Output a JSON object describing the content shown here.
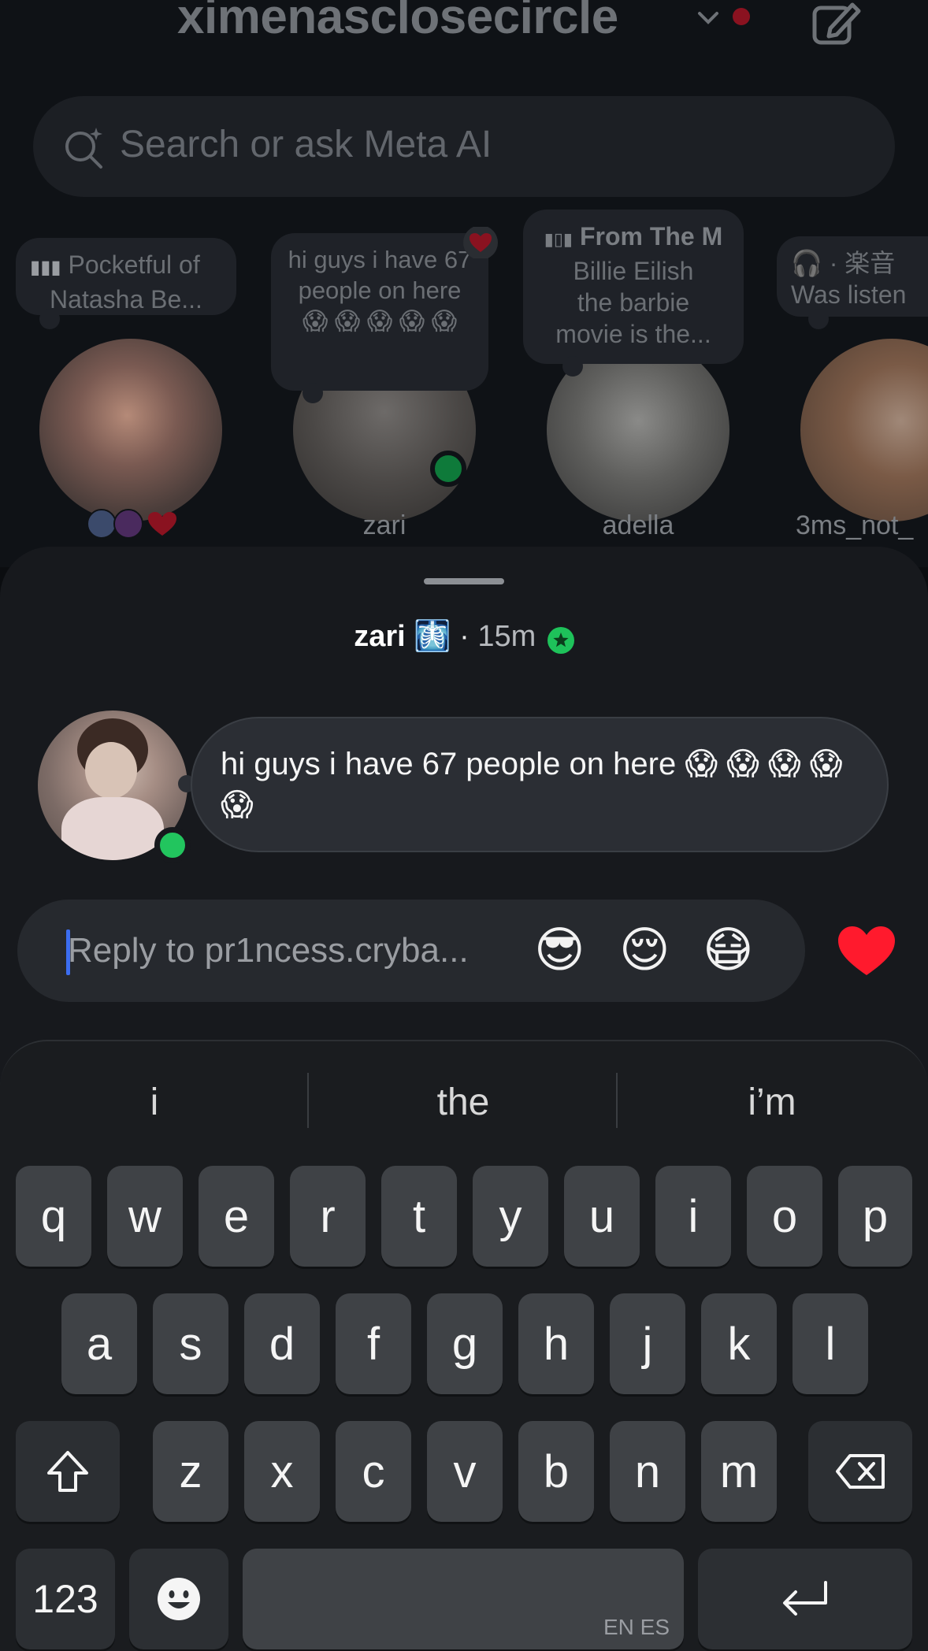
{
  "header": {
    "title": "ximenasclosecircle"
  },
  "search": {
    "placeholder": "Search or ask Meta AI"
  },
  "notes": [
    {
      "line1": "❘❙❘ Pocketful of",
      "line2": "Natasha Be...",
      "user": ""
    },
    {
      "text": "hi guys i have 67 people on here 😱 😱 😱 😱 😱",
      "user": "zari 🩻"
    },
    {
      "line1": "From The M",
      "line2": "Billie Eilish",
      "line3": "the barbie",
      "line4": "movie is the...",
      "user": "adella"
    },
    {
      "line1": "· 楽音",
      "line2": "Was listen",
      "user": "3ms_not_"
    }
  ],
  "note_users": [
    "zari",
    "adella",
    "3ms_not_"
  ],
  "sheet": {
    "name": "zari",
    "time": "15m",
    "message": "hi guys i have 67 people on here 😱 😱 😱 😱 😱",
    "reply_placeholder": "Reply to pr1ncess.cryba...",
    "quick_emojis": [
      "😎",
      "😌",
      "😷"
    ]
  },
  "keyboard": {
    "suggestions": [
      "i",
      "the",
      "i’m"
    ],
    "row1": [
      "q",
      "w",
      "e",
      "r",
      "t",
      "y",
      "u",
      "i",
      "o",
      "p"
    ],
    "row2": [
      "a",
      "s",
      "d",
      "f",
      "g",
      "h",
      "j",
      "k",
      "l"
    ],
    "row3": [
      "z",
      "x",
      "c",
      "v",
      "b",
      "n",
      "m"
    ],
    "numbers_label": "123",
    "space_lang": "EN ES"
  },
  "colors": {
    "accent_blue": "#3c6df0",
    "online_green": "#22c55e",
    "heart_red": "#ff1a2d"
  }
}
